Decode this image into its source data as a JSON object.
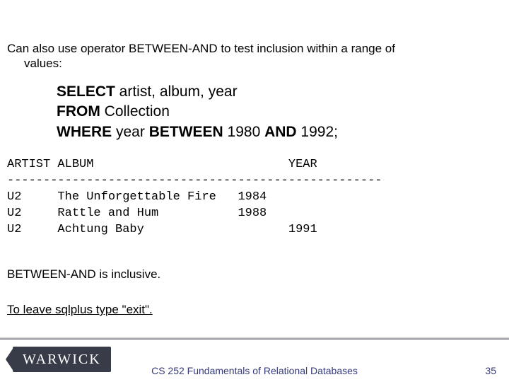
{
  "intro": {
    "line1": "Can also use operator BETWEEN-AND to test inclusion within a range of",
    "line2": "values:"
  },
  "sql": {
    "select_kw": "SELECT",
    "select_cols": " artist, album, year",
    "from_kw": "FROM",
    "from_tbl": " Collection",
    "where_kw": "WHERE",
    "where_col": " year ",
    "between_kw": "BETWEEN",
    "between_lo": " 1980 ",
    "and_kw": "AND",
    "between_hi": " 1992;"
  },
  "result_text": "ARTIST ALBUM                           YEAR\n----------------------------------------------------\nU2     The Unforgettable Fire   1984\nU2     Rattle and Hum           1988\nU2     Achtung Baby                    1991",
  "note1": "BETWEEN-AND is inclusive.",
  "note2": "To leave sqlplus type \"exit\".",
  "logo_text": "WARWICK",
  "footer": "CS 252 Fundamentals of Relational Databases",
  "page": "35",
  "chart_data": {
    "type": "table",
    "columns": [
      "ARTIST",
      "ALBUM",
      "YEAR"
    ],
    "rows": [
      [
        "U2",
        "The Unforgettable Fire",
        1984
      ],
      [
        "U2",
        "Rattle and Hum",
        1988
      ],
      [
        "U2",
        "Achtung Baby",
        1991
      ]
    ]
  }
}
